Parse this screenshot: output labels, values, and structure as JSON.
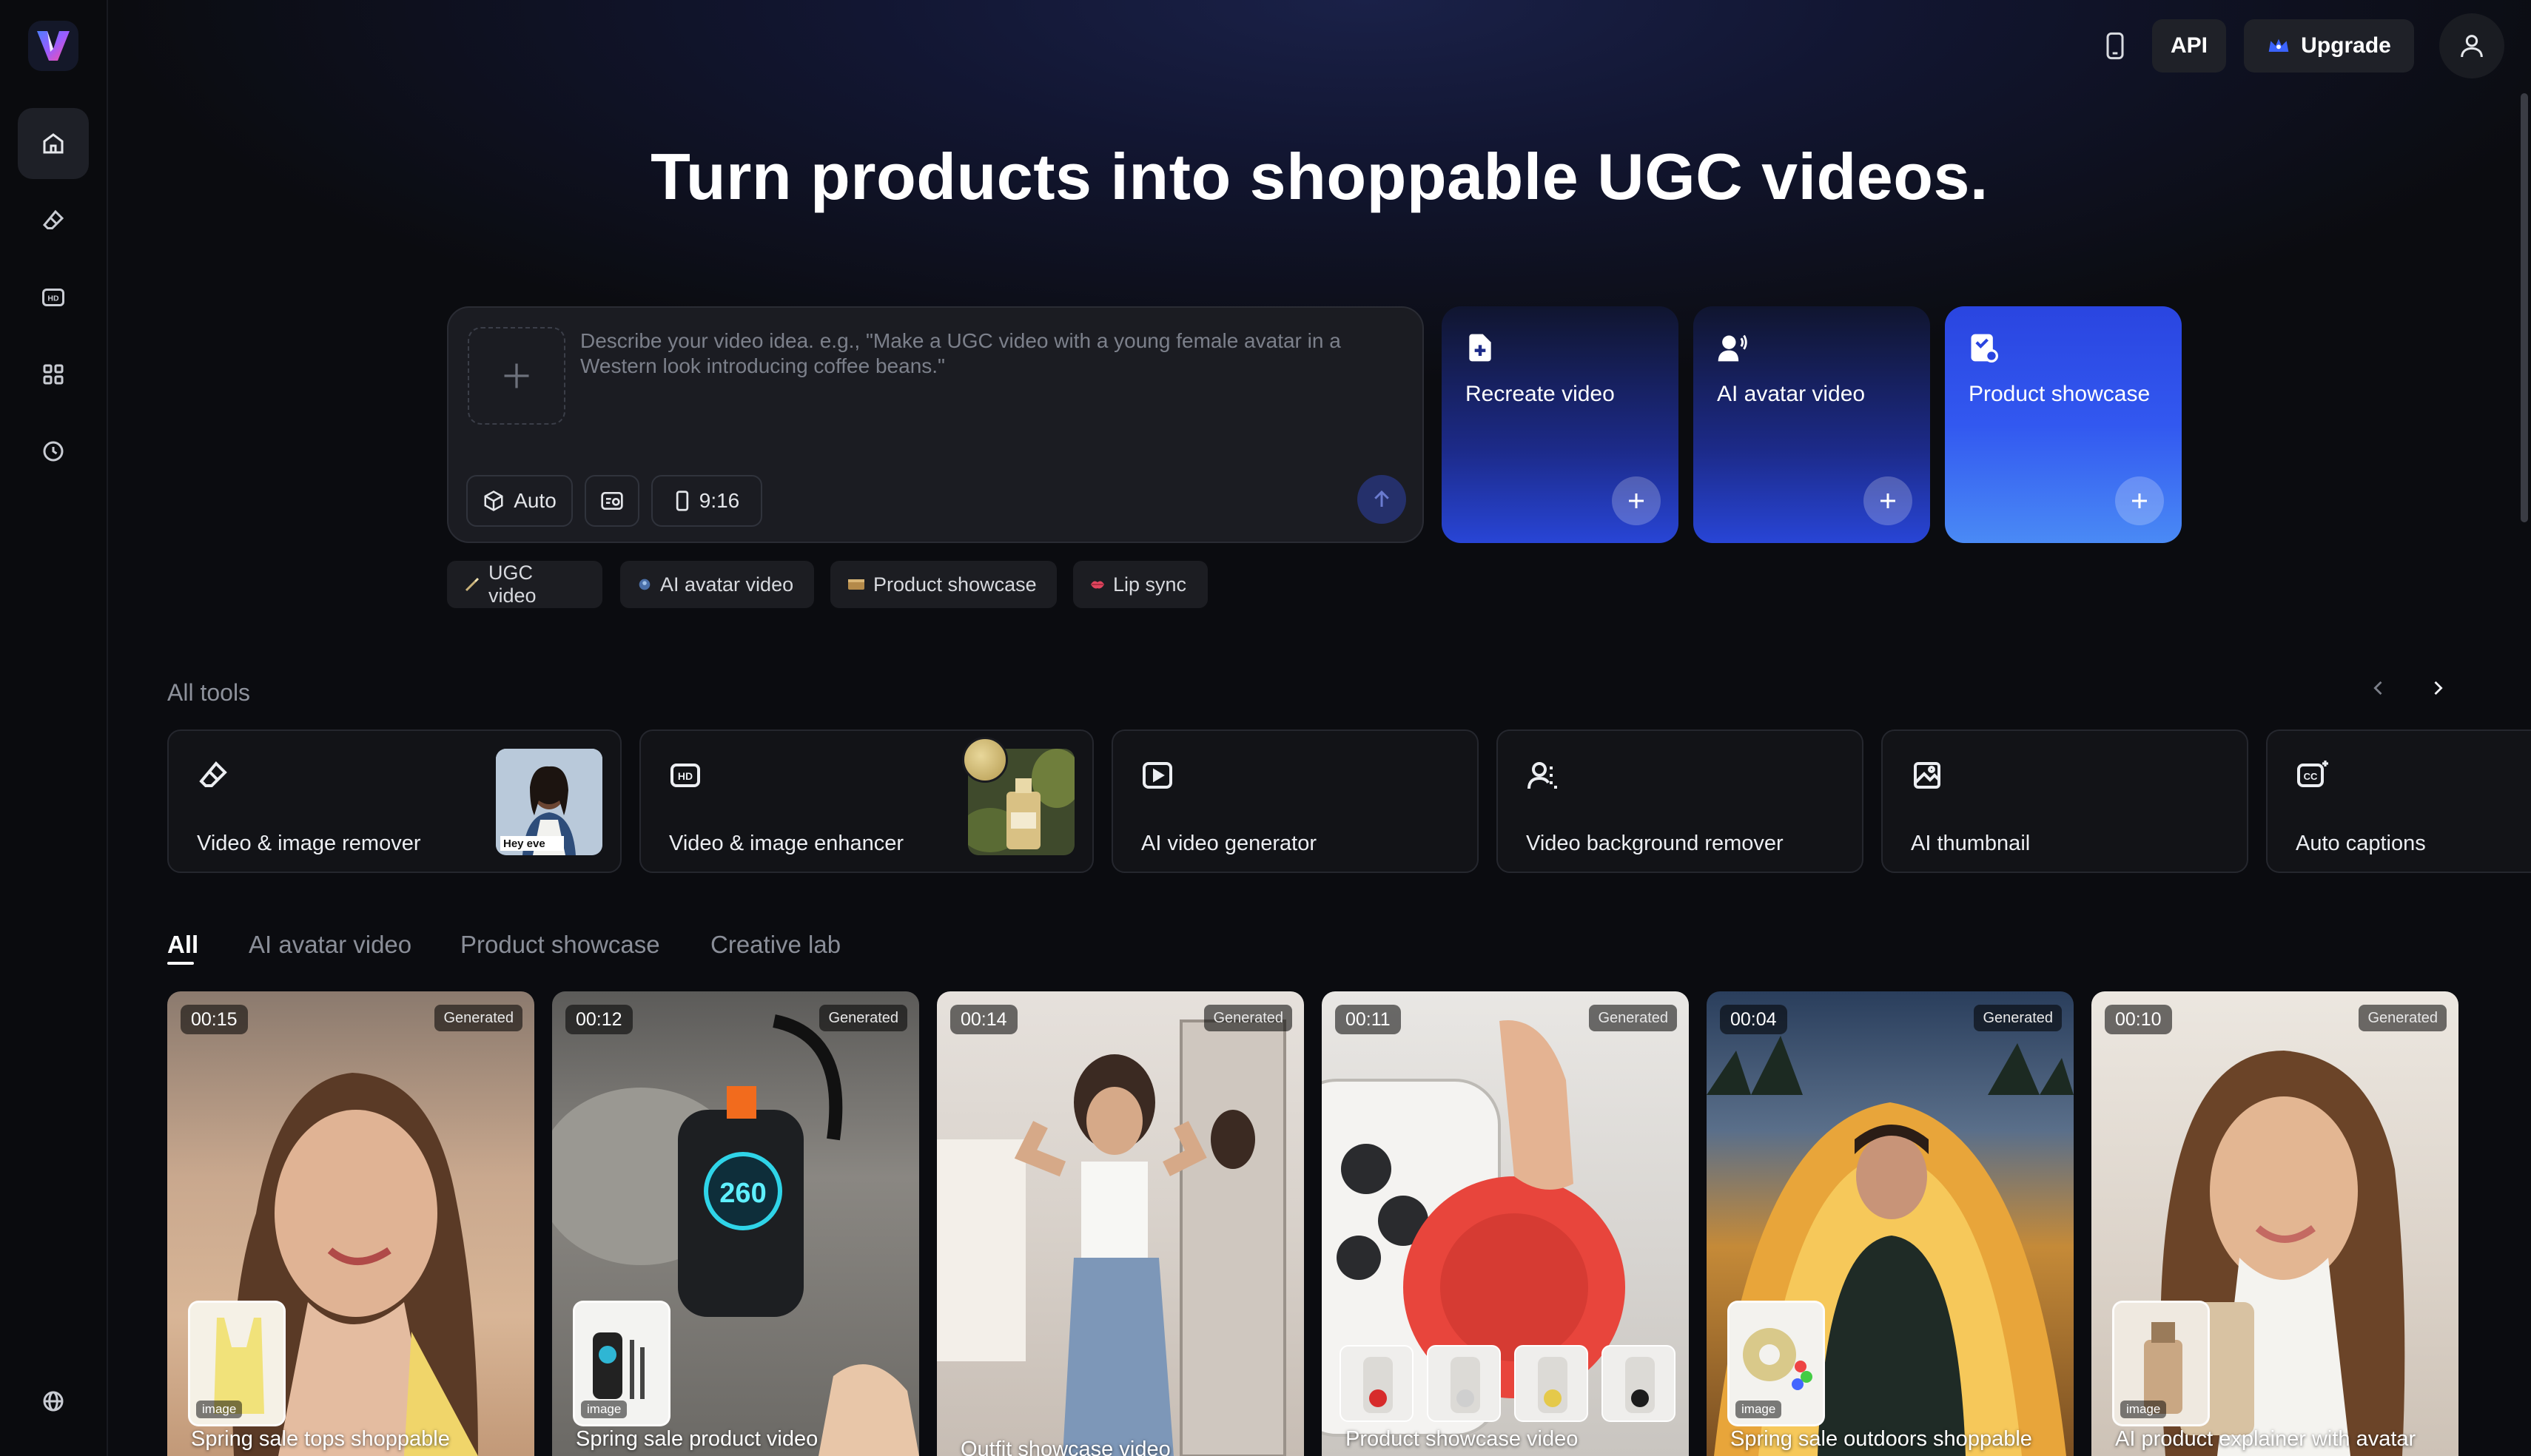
{
  "header": {
    "api_label": "API",
    "upgrade_label": "Upgrade"
  },
  "hero": {
    "title": "Turn products into shoppable UGC videos."
  },
  "prompt": {
    "placeholder": "Describe your video idea. e.g., \"Make a UGC video with a young female avatar in a Western look introducing coffee beans.\"",
    "model_label": "Auto",
    "ratio_label": "9:16"
  },
  "create_cards": [
    {
      "label": "Recreate video"
    },
    {
      "label": "AI avatar video"
    },
    {
      "label": "Product showcase"
    }
  ],
  "chips": [
    {
      "label": "UGC video"
    },
    {
      "label": "AI avatar video"
    },
    {
      "label": "Product showcase"
    },
    {
      "label": "Lip sync"
    }
  ],
  "tools": {
    "section_label": "All tools",
    "items": [
      {
        "label": "Video & image remover",
        "thumb_text": "Hey eve"
      },
      {
        "label": "Video & image enhancer"
      },
      {
        "label": "AI video generator"
      },
      {
        "label": "Video background remover"
      },
      {
        "label": "AI thumbnail"
      },
      {
        "label": "Auto captions"
      }
    ]
  },
  "tabs": [
    {
      "label": "All"
    },
    {
      "label": "AI avatar video"
    },
    {
      "label": "Product showcase"
    },
    {
      "label": "Creative lab"
    }
  ],
  "gallery": [
    {
      "time": "00:15",
      "badge": "Generated",
      "title": "Spring sale tops shoppable",
      "thumb_label": "image"
    },
    {
      "time": "00:12",
      "badge": "Generated",
      "title": "Spring sale product video",
      "thumb_label": "image"
    },
    {
      "time": "00:14",
      "badge": "Generated",
      "title": "Outfit showcase video"
    },
    {
      "time": "00:11",
      "badge": "Generated",
      "title": "Product showcase video"
    },
    {
      "time": "00:04",
      "badge": "Generated",
      "title": "Spring sale outdoors shoppable",
      "thumb_label": "image"
    },
    {
      "time": "00:10",
      "badge": "Generated",
      "title": "AI product explainer with avatar",
      "thumb_label": "image"
    }
  ],
  "colors": {
    "background": "#0b0c10",
    "accent_blue": "#2f55e8"
  }
}
